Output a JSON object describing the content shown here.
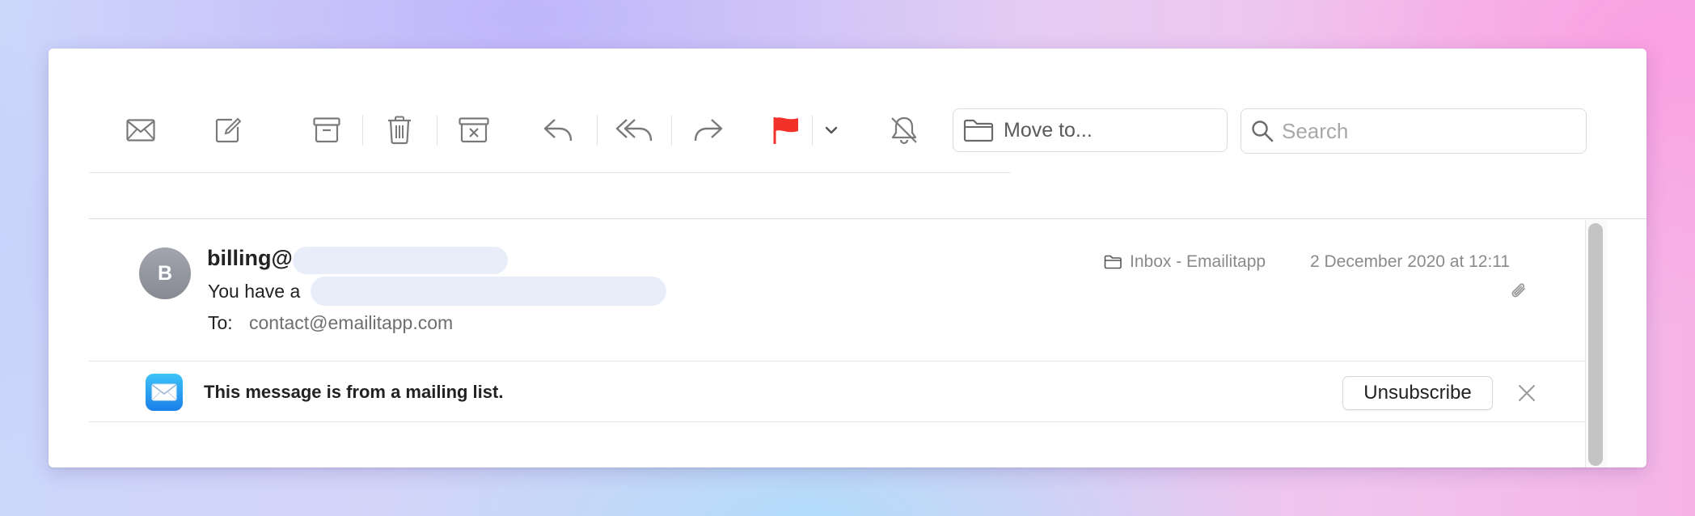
{
  "toolbar": {
    "buttons": [
      {
        "id": "get-mail",
        "icon": "envelope-icon"
      },
      {
        "id": "compose",
        "icon": "compose-icon"
      },
      {
        "id": "archive",
        "icon": "archive-box-icon"
      },
      {
        "id": "delete",
        "icon": "trash-icon"
      },
      {
        "id": "junk",
        "icon": "junk-box-icon"
      },
      {
        "id": "reply",
        "icon": "reply-icon"
      },
      {
        "id": "reply-all",
        "icon": "reply-all-icon"
      },
      {
        "id": "forward",
        "icon": "forward-icon"
      },
      {
        "id": "flag",
        "icon": "flag-icon"
      },
      {
        "id": "flag-menu",
        "icon": "chevron-down-icon"
      },
      {
        "id": "mute",
        "icon": "bell-slash-icon"
      }
    ],
    "move_to_label": "Move to...",
    "search_placeholder": "Search"
  },
  "message": {
    "avatar_initial": "B",
    "sender": "billing@",
    "subject_prefix": "You have a",
    "to_label": "To:",
    "to_value": "contact@emailitapp.com",
    "mailbox": "Inbox - Emailitapp",
    "date": "2 December 2020 at 12:11",
    "has_attachment_icon": "paperclip-icon"
  },
  "banner": {
    "text": "This message is from a mailing list.",
    "unsubscribe_label": "Unsubscribe",
    "close_icon": "close-icon"
  },
  "colors": {
    "flag": "#f2322a",
    "icon_gray": "#7a7a7a",
    "secondary_text": "#8a8a8a",
    "mail_icon_top": "#3ec3f8",
    "mail_icon_bottom": "#1a7fea"
  }
}
